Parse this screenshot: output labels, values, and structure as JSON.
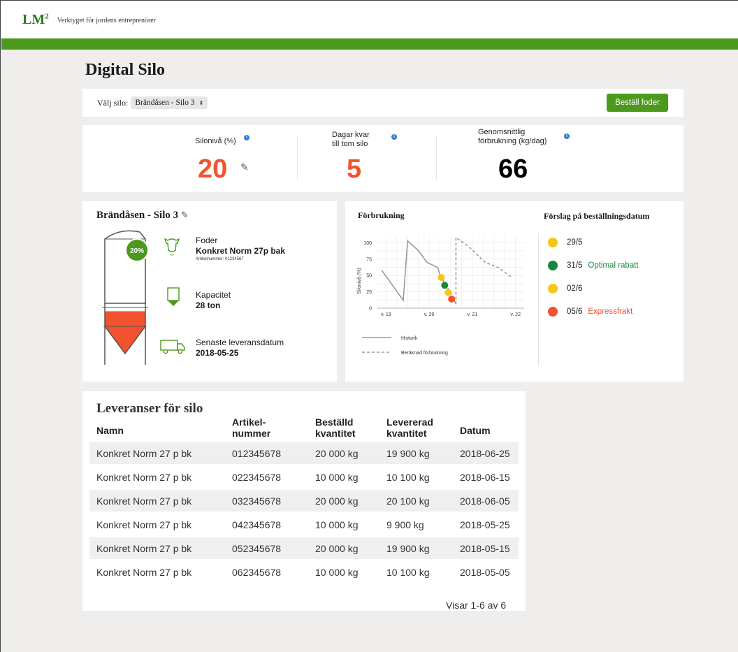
{
  "header": {
    "logo": "LM",
    "logo_sup": "2",
    "tagline": "Verktyget för jordens entreprenörer"
  },
  "page_title": "Digital Silo",
  "selector": {
    "label": "Välj silo:",
    "value": "Brändåsen - Silo 3",
    "order_button": "Beställ foder"
  },
  "stats": {
    "level_label": "Silonivå (%)",
    "level_value": "20",
    "days_label_1": "Dagar kvar",
    "days_label_2": "till tom silo",
    "days_value": "5",
    "avg_label_1": "Genomsnittlig",
    "avg_label_2": "förbrukning (kg/dag)",
    "avg_value": "66",
    "info_glyph": "i"
  },
  "silo": {
    "title": "Brändåsen - Silo 3",
    "fill_badge": "20%",
    "fill_level": 0.2,
    "feed_label": "Foder",
    "feed_name": "Konkret Norm 27p bak",
    "article_number": "Artikelnummer: 01234567",
    "capacity_label": "Kapacitet",
    "capacity_value": "28 ton",
    "delivery_label": "Senaste  leveransdatum",
    "delivery_value": "2018-05-25"
  },
  "chart_data": {
    "type": "line",
    "title": "Förbrukning",
    "ylabel": "Silonivå (%)",
    "ylim": [
      0,
      110
    ],
    "y_ticks": [
      "100",
      "75",
      "50",
      "25",
      "0"
    ],
    "x_ticks": [
      "v. 19",
      "v. 20",
      "v. 21",
      "v. 22"
    ],
    "series": [
      {
        "name": "Historik",
        "style": "solid",
        "x": [
          18.9,
          19.4,
          19.5,
          19.75,
          19.95,
          20.2,
          20.25
        ],
        "y": [
          58,
          12,
          103,
          88,
          70,
          62,
          50
        ]
      },
      {
        "name": "Beräknad förbrukning",
        "style": "dashed",
        "x": [
          20.25,
          20.55,
          20.62,
          20.62,
          20.9,
          21.3,
          21.6,
          21.9
        ],
        "y": [
          50,
          18,
          5,
          108,
          95,
          70,
          62,
          48
        ]
      }
    ],
    "markers": [
      {
        "x": 20.28,
        "y": 47,
        "color": "#f5c518"
      },
      {
        "x": 20.36,
        "y": 35,
        "color": "#14893a"
      },
      {
        "x": 20.44,
        "y": 24,
        "color": "#f5c518"
      },
      {
        "x": 20.52,
        "y": 14,
        "color": "#f2522d"
      }
    ]
  },
  "suggestions": {
    "title": "Förslag på beställningsdatum",
    "items": [
      {
        "date": "29/5",
        "note": "",
        "color": "#f5c518",
        "note_color": "#14893a"
      },
      {
        "date": "31/5",
        "note": "Optimal rabatt",
        "color": "#14893a",
        "note_color": "#14893a"
      },
      {
        "date": "02/6",
        "note": "",
        "color": "#f5c518",
        "note_color": "#14893a"
      },
      {
        "date": "05/6",
        "note": "Expressfrakt",
        "color": "#f2522d",
        "note_color": "#f2522d"
      }
    ]
  },
  "deliveries": {
    "title": "Leveranser för silo",
    "headers": {
      "name": "Namn",
      "article_1": "Artikel-",
      "article_2": "nummer",
      "ordered_1": "Beställd",
      "ordered_2": "kvantitet",
      "delivered_1": "Levererad",
      "delivered_2": "kvantitet",
      "date": "Datum"
    },
    "rows": [
      {
        "name": "Konkret Norm 27 p bk",
        "article": "012345678",
        "ordered": "20 000 kg",
        "delivered": "19 900 kg",
        "date": "2018-06-25"
      },
      {
        "name": "Konkret Norm 27 p bk",
        "article": "022345678",
        "ordered": "10 000 kg",
        "delivered": "10 100 kg",
        "date": "2018-06-15"
      },
      {
        "name": "Konkret Norm 27 p bk",
        "article": "032345678",
        "ordered": "20 000 kg",
        "delivered": "20 100 kg",
        "date": "2018-06-05"
      },
      {
        "name": "Konkret Norm 27 p bk",
        "article": "042345678",
        "ordered": "10 000 kg",
        "delivered": "9 900 kg",
        "date": "2018-05-25"
      },
      {
        "name": "Konkret Norm 27 p bk",
        "article": "052345678",
        "ordered": "20 000 kg",
        "delivered": "19 900 kg",
        "date": "2018-05-15"
      },
      {
        "name": "Konkret Norm 27 p bk",
        "article": "062345678",
        "ordered": "10 000 kg",
        "delivered": "10 100 kg",
        "date": "2018-05-05"
      }
    ],
    "paging": "Visar 1-6 av 6"
  },
  "colors": {
    "brand_green": "#4c9a1c",
    "level_red": "#f2522d",
    "info_blue": "#2f7bd6",
    "silo_fill": "#f2522d"
  }
}
